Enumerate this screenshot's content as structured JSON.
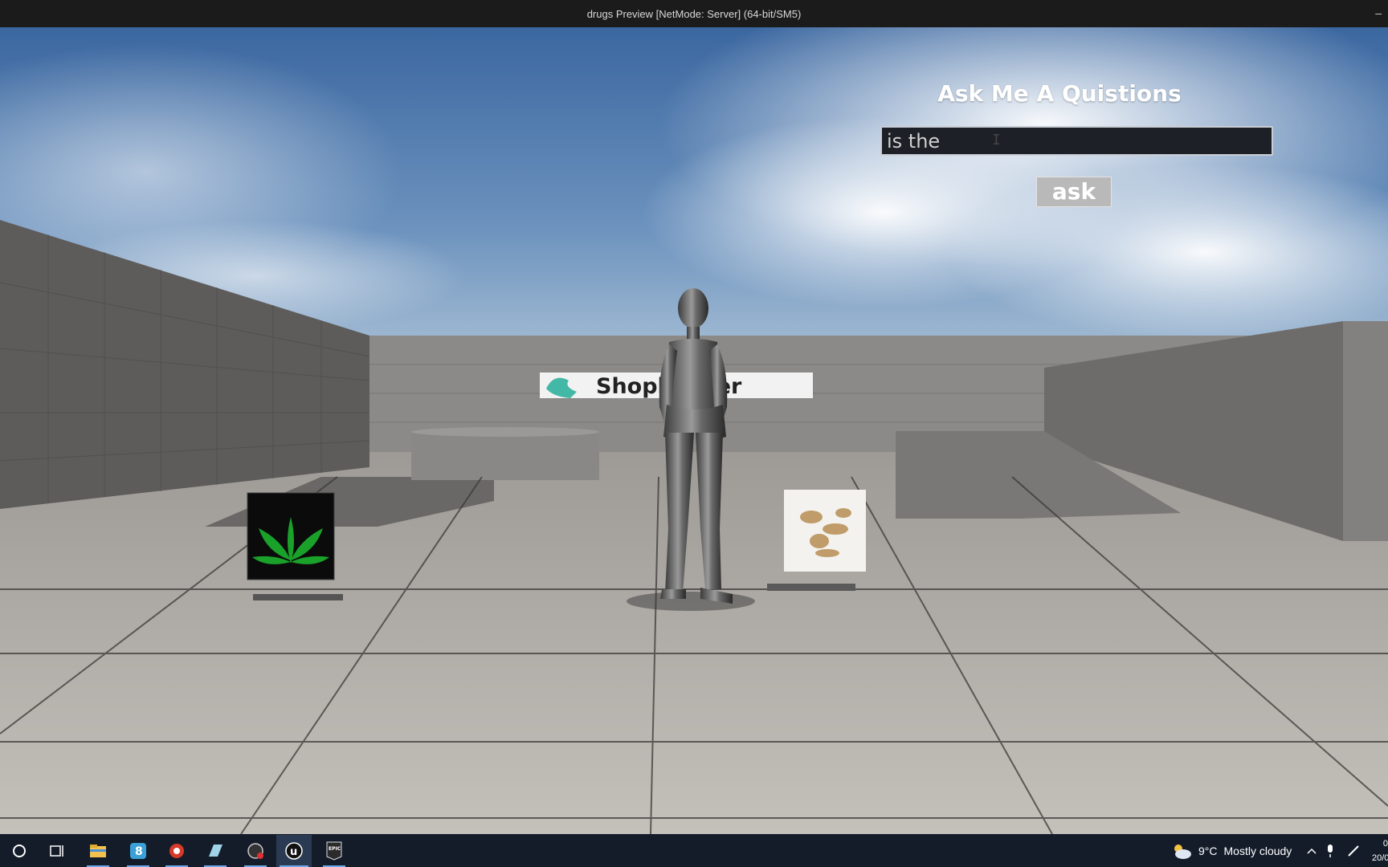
{
  "window": {
    "title": "drugs Preview [NetMode: Server]  (64-bit/SM5)",
    "minimize_glyph": "–"
  },
  "game_ui": {
    "heading": "Ask Me A Quistions",
    "input_value": "is the",
    "ask_label": "ask"
  },
  "scene": {
    "sign_text": "Shopkeeper",
    "props": [
      "cannabis-leaf-cube",
      "mushrooms-cube",
      "mannequin-character"
    ]
  },
  "taskbar": {
    "apps": [
      "cortana-search-icon",
      "task-view-icon",
      "file-explorer-icon",
      "app-s-icon",
      "app-red-icon",
      "notes-icon",
      "obs-icon",
      "unreal-engine-icon",
      "epic-games-icon"
    ],
    "weather_temp": "9°C",
    "weather_desc": "Mostly cloudy",
    "clock_time": "0",
    "clock_date": "20/0"
  },
  "colors": {
    "sky_top": "#3d6aa3",
    "floor": "#b8b4ae",
    "input_bg": "#1d2026",
    "button_bg": "#b9b9b9"
  }
}
